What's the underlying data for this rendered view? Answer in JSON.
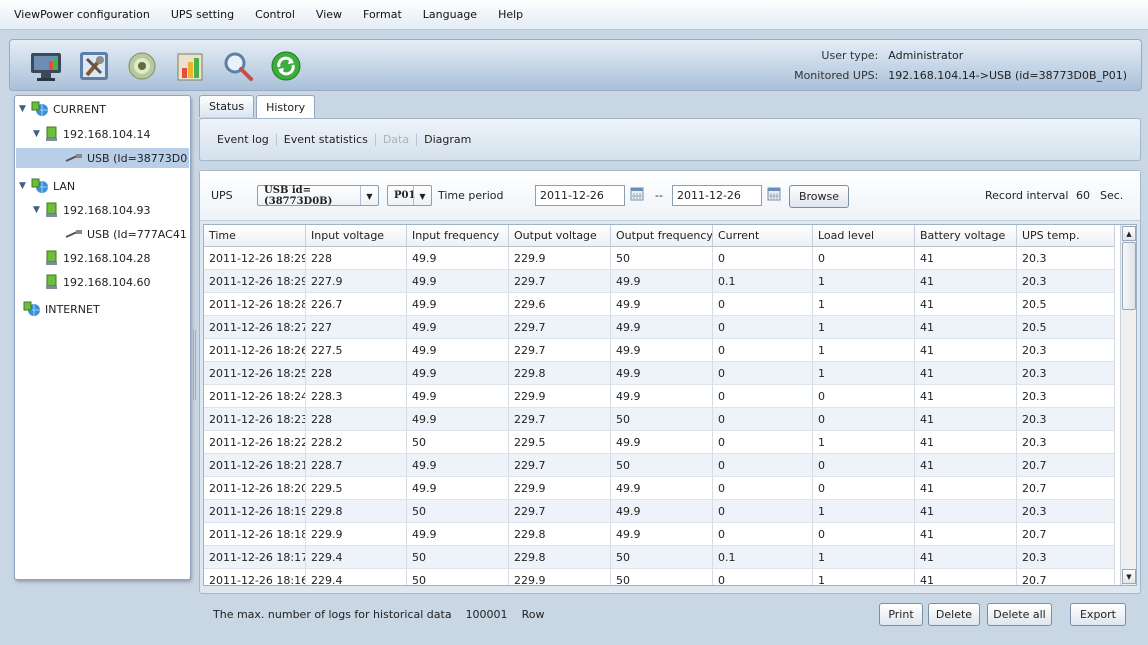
{
  "menu": [
    "ViewPower configuration",
    "UPS setting",
    "Control",
    "View",
    "Format",
    "Language",
    "Help"
  ],
  "toolbar": {
    "icons": [
      "monitor-icon",
      "tools-icon",
      "cd-icon",
      "chart-icon",
      "search-icon",
      "refresh-icon"
    ],
    "user_type_label": "User type:",
    "user_type_value": "Administrator",
    "monitored_ups_label": "Monitored UPS:",
    "monitored_ups_value": "192.168.104.14->USB (id=38773D0B_P01)"
  },
  "tree": {
    "current": "CURRENT",
    "current_host": "192.168.104.14",
    "current_usb": "USB (Id=38773D0",
    "lan": "LAN",
    "lan_host1": "192.168.104.93",
    "lan_usb": "USB (Id=777AC41",
    "lan_host2": "192.168.104.28",
    "lan_host3": "192.168.104.60",
    "internet": "INTERNET"
  },
  "tabs": [
    "Status",
    "History"
  ],
  "subnav": [
    "Event log",
    "Event statistics",
    "Data",
    "Diagram"
  ],
  "filter": {
    "ups_label": "UPS",
    "ups_value": "USB id=(38773D0B)",
    "port_value": "P01",
    "time_period_label": "Time period",
    "date_from": "2011-12-26",
    "date_sep": "--",
    "date_to": "2011-12-26",
    "browse_label": "Browse",
    "record_interval_label": "Record interval",
    "record_interval_value": "60",
    "record_interval_unit": "Sec."
  },
  "table": {
    "columns": [
      "Time",
      "Input voltage",
      "Input frequency",
      "Output voltage",
      "Output frequency",
      "Current",
      "Load level",
      "Battery voltage",
      "UPS temp."
    ],
    "rows": [
      [
        "2011-12-26 18:29:",
        "228",
        "49.9",
        "229.9",
        "50",
        "0",
        "0",
        "41",
        "20.3"
      ],
      [
        "2011-12-26 18:29:",
        "227.9",
        "49.9",
        "229.7",
        "49.9",
        "0.1",
        "1",
        "41",
        "20.3"
      ],
      [
        "2011-12-26 18:28:",
        "226.7",
        "49.9",
        "229.6",
        "49.9",
        "0",
        "1",
        "41",
        "20.5"
      ],
      [
        "2011-12-26 18:27:",
        "227",
        "49.9",
        "229.7",
        "49.9",
        "0",
        "1",
        "41",
        "20.5"
      ],
      [
        "2011-12-26 18:26:",
        "227.5",
        "49.9",
        "229.7",
        "49.9",
        "0",
        "1",
        "41",
        "20.3"
      ],
      [
        "2011-12-26 18:25:",
        "228",
        "49.9",
        "229.8",
        "49.9",
        "0",
        "1",
        "41",
        "20.3"
      ],
      [
        "2011-12-26 18:24:",
        "228.3",
        "49.9",
        "229.9",
        "49.9",
        "0",
        "0",
        "41",
        "20.3"
      ],
      [
        "2011-12-26 18:23:",
        "228",
        "49.9",
        "229.7",
        "50",
        "0",
        "0",
        "41",
        "20.3"
      ],
      [
        "2011-12-26 18:22:",
        "228.2",
        "50",
        "229.5",
        "49.9",
        "0",
        "1",
        "41",
        "20.3"
      ],
      [
        "2011-12-26 18:21:",
        "228.7",
        "49.9",
        "229.7",
        "50",
        "0",
        "0",
        "41",
        "20.7"
      ],
      [
        "2011-12-26 18:20:",
        "229.5",
        "49.9",
        "229.9",
        "49.9",
        "0",
        "0",
        "41",
        "20.7"
      ],
      [
        "2011-12-26 18:19:",
        "229.8",
        "50",
        "229.7",
        "49.9",
        "0",
        "1",
        "41",
        "20.3"
      ],
      [
        "2011-12-26 18:18:",
        "229.9",
        "49.9",
        "229.8",
        "49.9",
        "0",
        "0",
        "41",
        "20.7"
      ],
      [
        "2011-12-26 18:17:",
        "229.4",
        "50",
        "229.8",
        "50",
        "0.1",
        "1",
        "41",
        "20.3"
      ],
      [
        "2011-12-26 18:16:",
        "229.4",
        "50",
        "229.9",
        "50",
        "0",
        "1",
        "41",
        "20.7"
      ]
    ]
  },
  "footer": {
    "max_logs_label": "The max. number of logs for historical data",
    "max_logs_value": "100001",
    "max_logs_unit": "Row",
    "print_label": "Print",
    "delete_label": "Delete",
    "delete_all_label": "Delete all",
    "export_label": "Export"
  }
}
